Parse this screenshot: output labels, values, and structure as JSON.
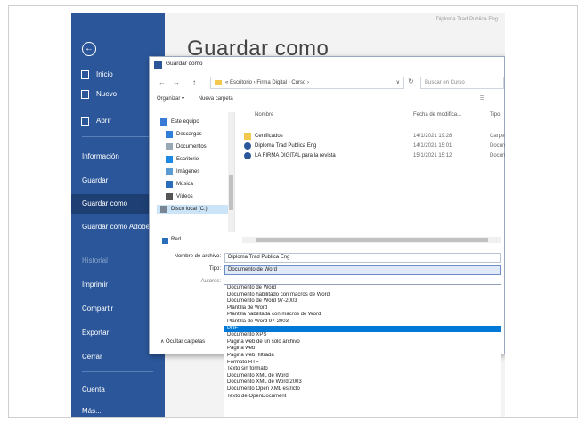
{
  "header": {
    "doc_name": "Diploma Trad Publica Eng",
    "page_title": "Guardar como"
  },
  "sidebar": {
    "back_glyph": "←",
    "top": [
      {
        "label": "Inicio",
        "icon": "home-icon"
      },
      {
        "label": "Nuevo",
        "icon": "new-doc-icon"
      },
      {
        "label": "Abrir",
        "icon": "folder-icon"
      }
    ],
    "items": [
      {
        "label": "Información"
      },
      {
        "label": "Guardar"
      },
      {
        "label": "Guardar como"
      },
      {
        "label": "Guardar como Adobe PDF"
      },
      {
        "label": "Historial"
      },
      {
        "label": "Imprimir"
      },
      {
        "label": "Compartir"
      },
      {
        "label": "Exportar"
      },
      {
        "label": "Cerrar"
      },
      {
        "label": "Cuenta"
      },
      {
        "label": "Más..."
      }
    ],
    "accent": "#2b579a"
  },
  "dialog": {
    "title": "Guardar como",
    "address": {
      "back": "←",
      "forward": "→",
      "up": "↑",
      "path": "« Escritorio › Firma Digital › Curso ›",
      "dropdown": "∨",
      "refresh": "↻",
      "search_placeholder": "Buscar en Curso"
    },
    "toolbar": {
      "organize": "Organizar ▾",
      "new_folder": "Nueva carpeta",
      "view_glyph": "☰"
    },
    "nav_pane": [
      {
        "label": "Este equipo",
        "icon": "computer-icon"
      },
      {
        "label": "Descargas",
        "icon": "download-icon"
      },
      {
        "label": "Documentos",
        "icon": "documents-icon"
      },
      {
        "label": "Escritorio",
        "icon": "desktop-icon"
      },
      {
        "label": "Imágenes",
        "icon": "pictures-icon"
      },
      {
        "label": "Música",
        "icon": "music-icon"
      },
      {
        "label": "Vídeos",
        "icon": "video-icon"
      },
      {
        "label": "Disco local (C:)",
        "icon": "drive-icon"
      }
    ],
    "network": "Red",
    "columns": {
      "name": "Nombre",
      "date": "Fecha de modifica...",
      "type": "Tipo"
    },
    "files": [
      {
        "name": "Certificados",
        "date": "14/1/2021 19:28",
        "type": "Carpeta",
        "icon": "folder-icon"
      },
      {
        "name": "Diploma Trad Publica Eng",
        "date": "14/1/2021 15:01",
        "type": "Docum",
        "icon": "word-doc-icon"
      },
      {
        "name": "LA FIRMA DIGITAL para la revista",
        "date": "15/1/2021 15:12",
        "type": "Docum",
        "icon": "word-doc-icon"
      }
    ],
    "form": {
      "filename_label": "Nombre de archivo:",
      "filename_value": "Diploma Trad Publica Eng",
      "type_label": "Tipo:",
      "type_value": "Documento de Word",
      "authors_label": "Autores:"
    },
    "type_options": [
      "Documento de Word",
      "Documento habilitado con macros de Word",
      "Documento de Word 97-2003",
      "Plantilla de Word",
      "Plantilla habilitada con macros de Word",
      "Plantilla de Word 97-2003",
      "PDF",
      "Documento XPS",
      "Página web de un solo archivo",
      "Página web",
      "Página web, filtrada",
      "Formato RTF",
      "Texto sin formato",
      "Documento XML de Word",
      "Documento XML de Word 2003",
      "Documento Open XML estricto",
      "Texto de OpenDocument"
    ],
    "selected_option": "PDF",
    "hide_folders": "∧ Ocultar carpetas"
  }
}
